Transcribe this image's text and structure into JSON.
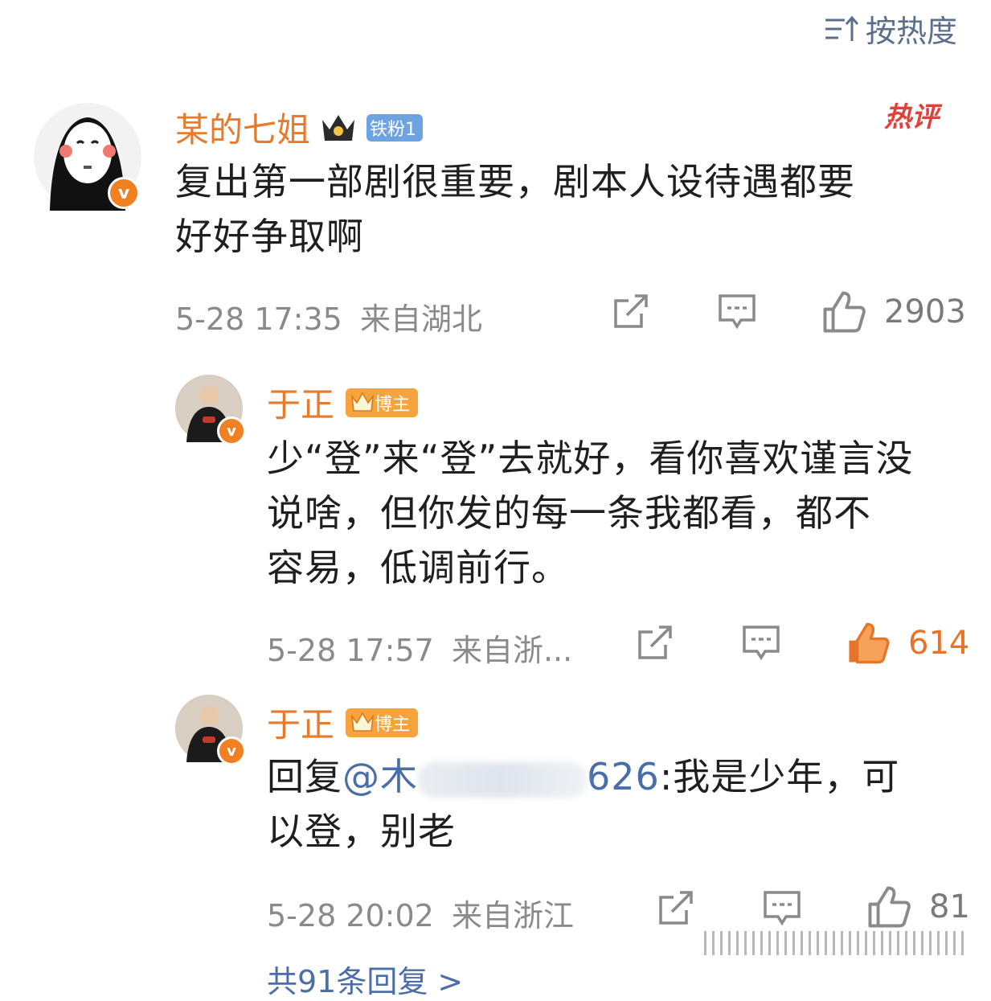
{
  "sort": {
    "label": "按热度",
    "icon": "sort-icon"
  },
  "comments": [
    {
      "user": "某的七姐",
      "level_badge": "铁粉1",
      "hot_tag": "热评",
      "text_line1": "复出第一部剧很重要，剧本人设待遇都要",
      "text_line2": "好好争取啊",
      "time": "5-28 17:35",
      "location": "来自湖北",
      "likes": "2903",
      "liked": false
    }
  ],
  "replies": [
    {
      "user": "于正",
      "badge": "博主",
      "text_line1": "少“登”来“登”去就好，看你喜欢谨言没",
      "text_line2": "说啥，但你发的每一条我都看，都不",
      "text_line3": "容易，低调前行。",
      "time": "5-28 17:57",
      "location": "来自浙...",
      "likes": "614",
      "liked": true
    },
    {
      "user": "于正",
      "badge": "博主",
      "reply_prefix": "回复",
      "mention_start": "@木",
      "mention_end": "626",
      "reply_after": ":我是少年，可",
      "text_line2": "以登，别老",
      "time": "5-28 20:02",
      "location": "来自浙江",
      "likes": "81",
      "liked": false
    }
  ],
  "footer": {
    "more_replies": "共91条回复 >"
  },
  "colors": {
    "username": "#e87a2b",
    "link": "#4a6ea8",
    "like_active": "#e8742a",
    "meta": "#8a8a8a"
  }
}
